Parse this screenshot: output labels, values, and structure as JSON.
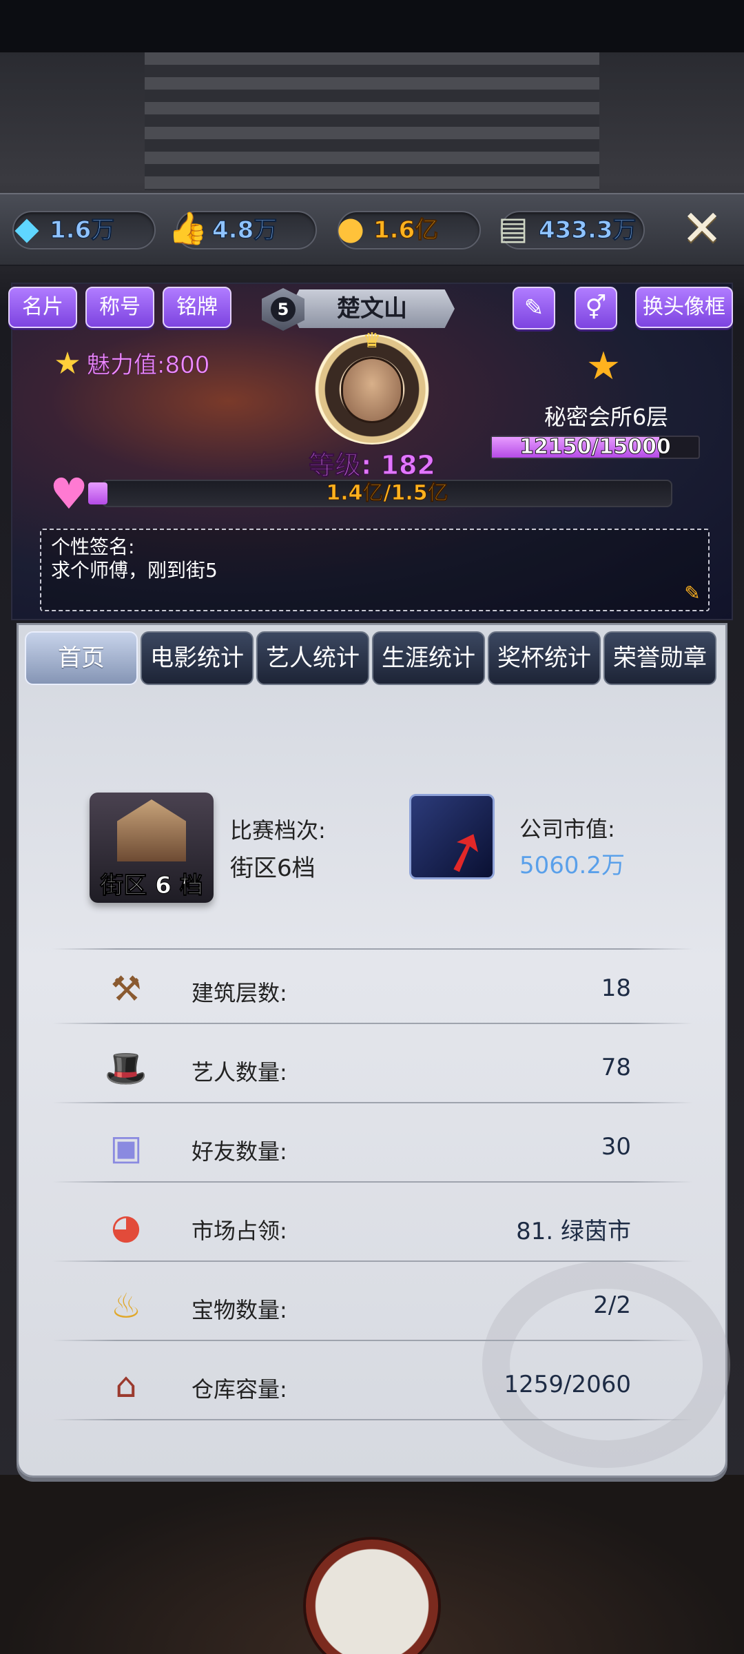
{
  "resources": [
    {
      "icon": "diamond-icon",
      "value": "1.6万"
    },
    {
      "icon": "thumbs-up-icon",
      "value": "4.8万"
    },
    {
      "icon": "gold-ingot-icon",
      "value": "1.6亿"
    },
    {
      "icon": "cash-stack-icon",
      "value": "433.3万"
    }
  ],
  "header": {
    "buttons": [
      "名片",
      "称号",
      "铭牌"
    ],
    "vip_level": "5",
    "player_name": "楚文山",
    "change_frame_label": "换头像框",
    "charm": "魅力值:800",
    "level": "等级: 182",
    "club": "秘密会所6层",
    "club_progress": "12150/15000",
    "club_progress_ratio": 0.81,
    "popularity": "1.4亿/1.5亿",
    "signature_label": "个性签名:",
    "signature_text": "求个师傅，刚到街5"
  },
  "tabs": [
    "首页",
    "电影统计",
    "艺人统计",
    "生涯统计",
    "奖杯统计",
    "荣誉勋章"
  ],
  "summary": {
    "district_badge": "街区 6 档",
    "match_label": "比赛档次:",
    "match_value": "街区6档",
    "corp_label": "公司市值:",
    "corp_value": "5060.2万"
  },
  "stats": [
    {
      "icon": "hammer-icon",
      "label": "建筑层数:",
      "value": "18"
    },
    {
      "icon": "top-hat-agent-icon",
      "label": "艺人数量:",
      "value": "78"
    },
    {
      "icon": "contact-book-icon",
      "label": "好友数量:",
      "value": "30"
    },
    {
      "icon": "pie-chart-icon",
      "label": "市场占领:",
      "value": "81. 绿茵市"
    },
    {
      "icon": "magic-lamp-icon",
      "label": "宝物数量:",
      "value": "2/2"
    },
    {
      "icon": "warehouse-icon",
      "label": "仓库容量:",
      "value": "1259/2060"
    }
  ]
}
